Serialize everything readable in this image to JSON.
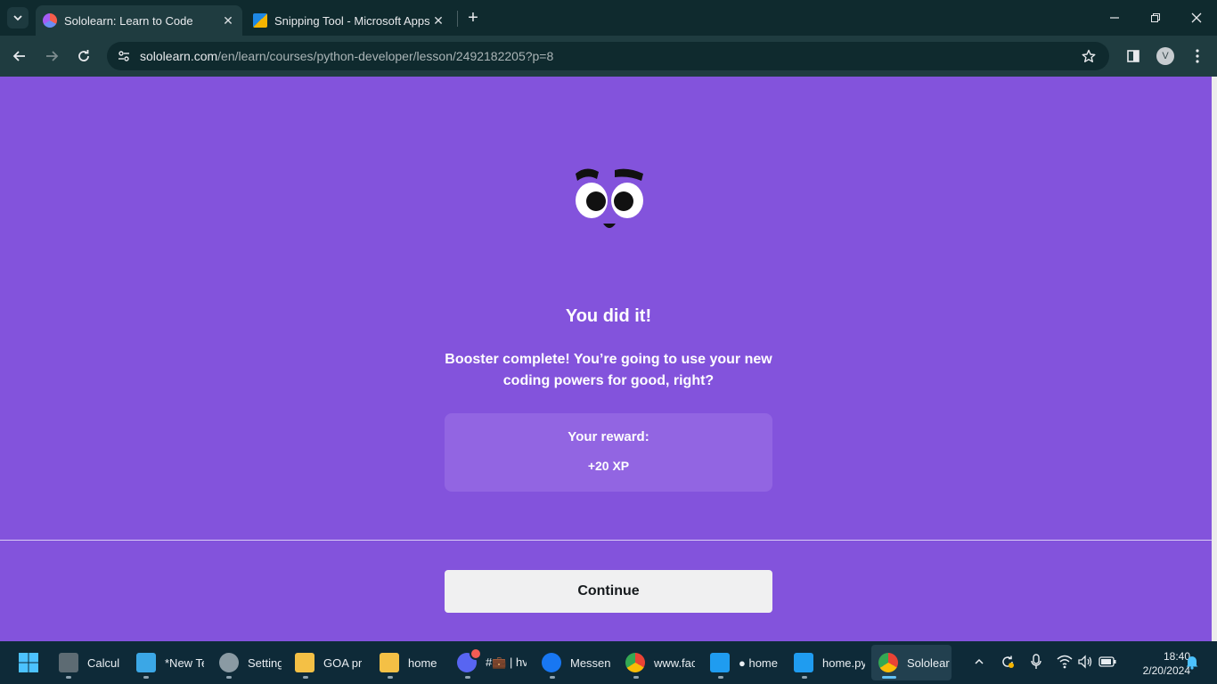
{
  "browser": {
    "tabs": [
      {
        "title": "Sololearn: Learn to Code",
        "active": true
      },
      {
        "title": "Snipping Tool - Microsoft Apps",
        "active": false
      }
    ],
    "url_host": "sololearn.com",
    "url_path": "/en/learn/courses/python-developer/lesson/2492182205?p=8",
    "profile_initial": "V"
  },
  "lesson": {
    "heading": "You did it!",
    "message": "Booster complete! You’re going to use your new coding powers for good, right?",
    "reward_label": "Your reward:",
    "reward_value": "+20 XP",
    "continue_label": "Continue"
  },
  "colors": {
    "background": "#8353dc",
    "reward_box": "#9265e2",
    "button": "#f0f0f1"
  },
  "taskbar": {
    "apps": [
      {
        "label": "Calcul",
        "icon": "calculator-icon"
      },
      {
        "label": "*New Te",
        "icon": "notepad-icon"
      },
      {
        "label": "Setting",
        "icon": "settings-icon"
      },
      {
        "label": "GOA pr",
        "icon": "folder-icon"
      },
      {
        "label": "home",
        "icon": "folder-icon"
      },
      {
        "label": "#💼 | hv",
        "icon": "discord-icon"
      },
      {
        "label": "Messen",
        "icon": "messenger-icon"
      },
      {
        "label": "www.fac",
        "icon": "chrome-icon"
      },
      {
        "label": "● home",
        "icon": "vscode-icon"
      },
      {
        "label": "home.py",
        "icon": "vscode-icon"
      },
      {
        "label": "Sololear",
        "icon": "chrome-icon"
      }
    ],
    "time": "18:40",
    "date": "2/20/2024"
  }
}
